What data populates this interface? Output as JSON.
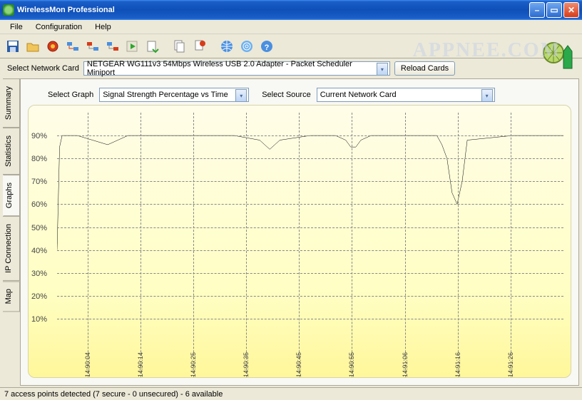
{
  "window": {
    "title": "WirelessMon Professional"
  },
  "menu": {
    "file": "File",
    "config": "Configuration",
    "help": "Help"
  },
  "toolbar": {
    "save": "save",
    "open": "open",
    "record": "record",
    "net1": "net1",
    "net2": "net2",
    "net3": "net3",
    "play": "play",
    "export": "export",
    "copy": "copy",
    "print": "print",
    "globe": "globe",
    "radar": "radar",
    "help": "help"
  },
  "row2": {
    "label": "Select Network Card",
    "card": "NETGEAR WG111v3 54Mbps Wireless USB 2.0 Adapter - Packet Scheduler Miniport",
    "reload": "Reload Cards"
  },
  "watermark": "APPNEE.COM",
  "tabs": {
    "summary": "Summary",
    "statistics": "Statistics",
    "graphs": "Graphs",
    "ip": "IP Connection",
    "map": "Map"
  },
  "graphctrl": {
    "selgraph": "Select Graph",
    "graph": "Signal Strength Percentage vs Time",
    "selsrc": "Select Source",
    "src": "Current Network Card"
  },
  "chart_data": {
    "type": "line",
    "title": "",
    "xlabel": "",
    "ylabel": "",
    "ylim": [
      0,
      100
    ],
    "y_ticks": [
      10,
      20,
      30,
      40,
      50,
      60,
      70,
      80,
      90
    ],
    "y_tick_labels": [
      "10%",
      "20%",
      "30%",
      "40%",
      "50%",
      "60%",
      "70%",
      "80%",
      "90%"
    ],
    "x_tick_labels": [
      "14:90:04",
      "14:90:14",
      "14:90:25",
      "14:90:35",
      "14:90:45",
      "14:90:55",
      "14:91:06",
      "14:91:16",
      "14:91:26"
    ],
    "x": [
      0,
      0.5,
      1,
      4,
      7,
      10,
      12,
      14,
      16,
      18,
      30,
      35,
      40,
      41,
      42,
      43,
      44,
      50,
      55,
      57,
      58,
      59,
      60,
      62,
      70,
      75,
      76,
      77,
      78,
      79,
      80,
      81,
      90,
      100
    ],
    "y": [
      40,
      85,
      90,
      90,
      88,
      86,
      88,
      90,
      90,
      90,
      90,
      90,
      88,
      86,
      84,
      86,
      88,
      90,
      90,
      88,
      85,
      85,
      88,
      90,
      90,
      90,
      86,
      80,
      65,
      60,
      70,
      88,
      90,
      90
    ]
  },
  "status": "7 access points detected (7 secure - 0 unsecured) - 6 available"
}
